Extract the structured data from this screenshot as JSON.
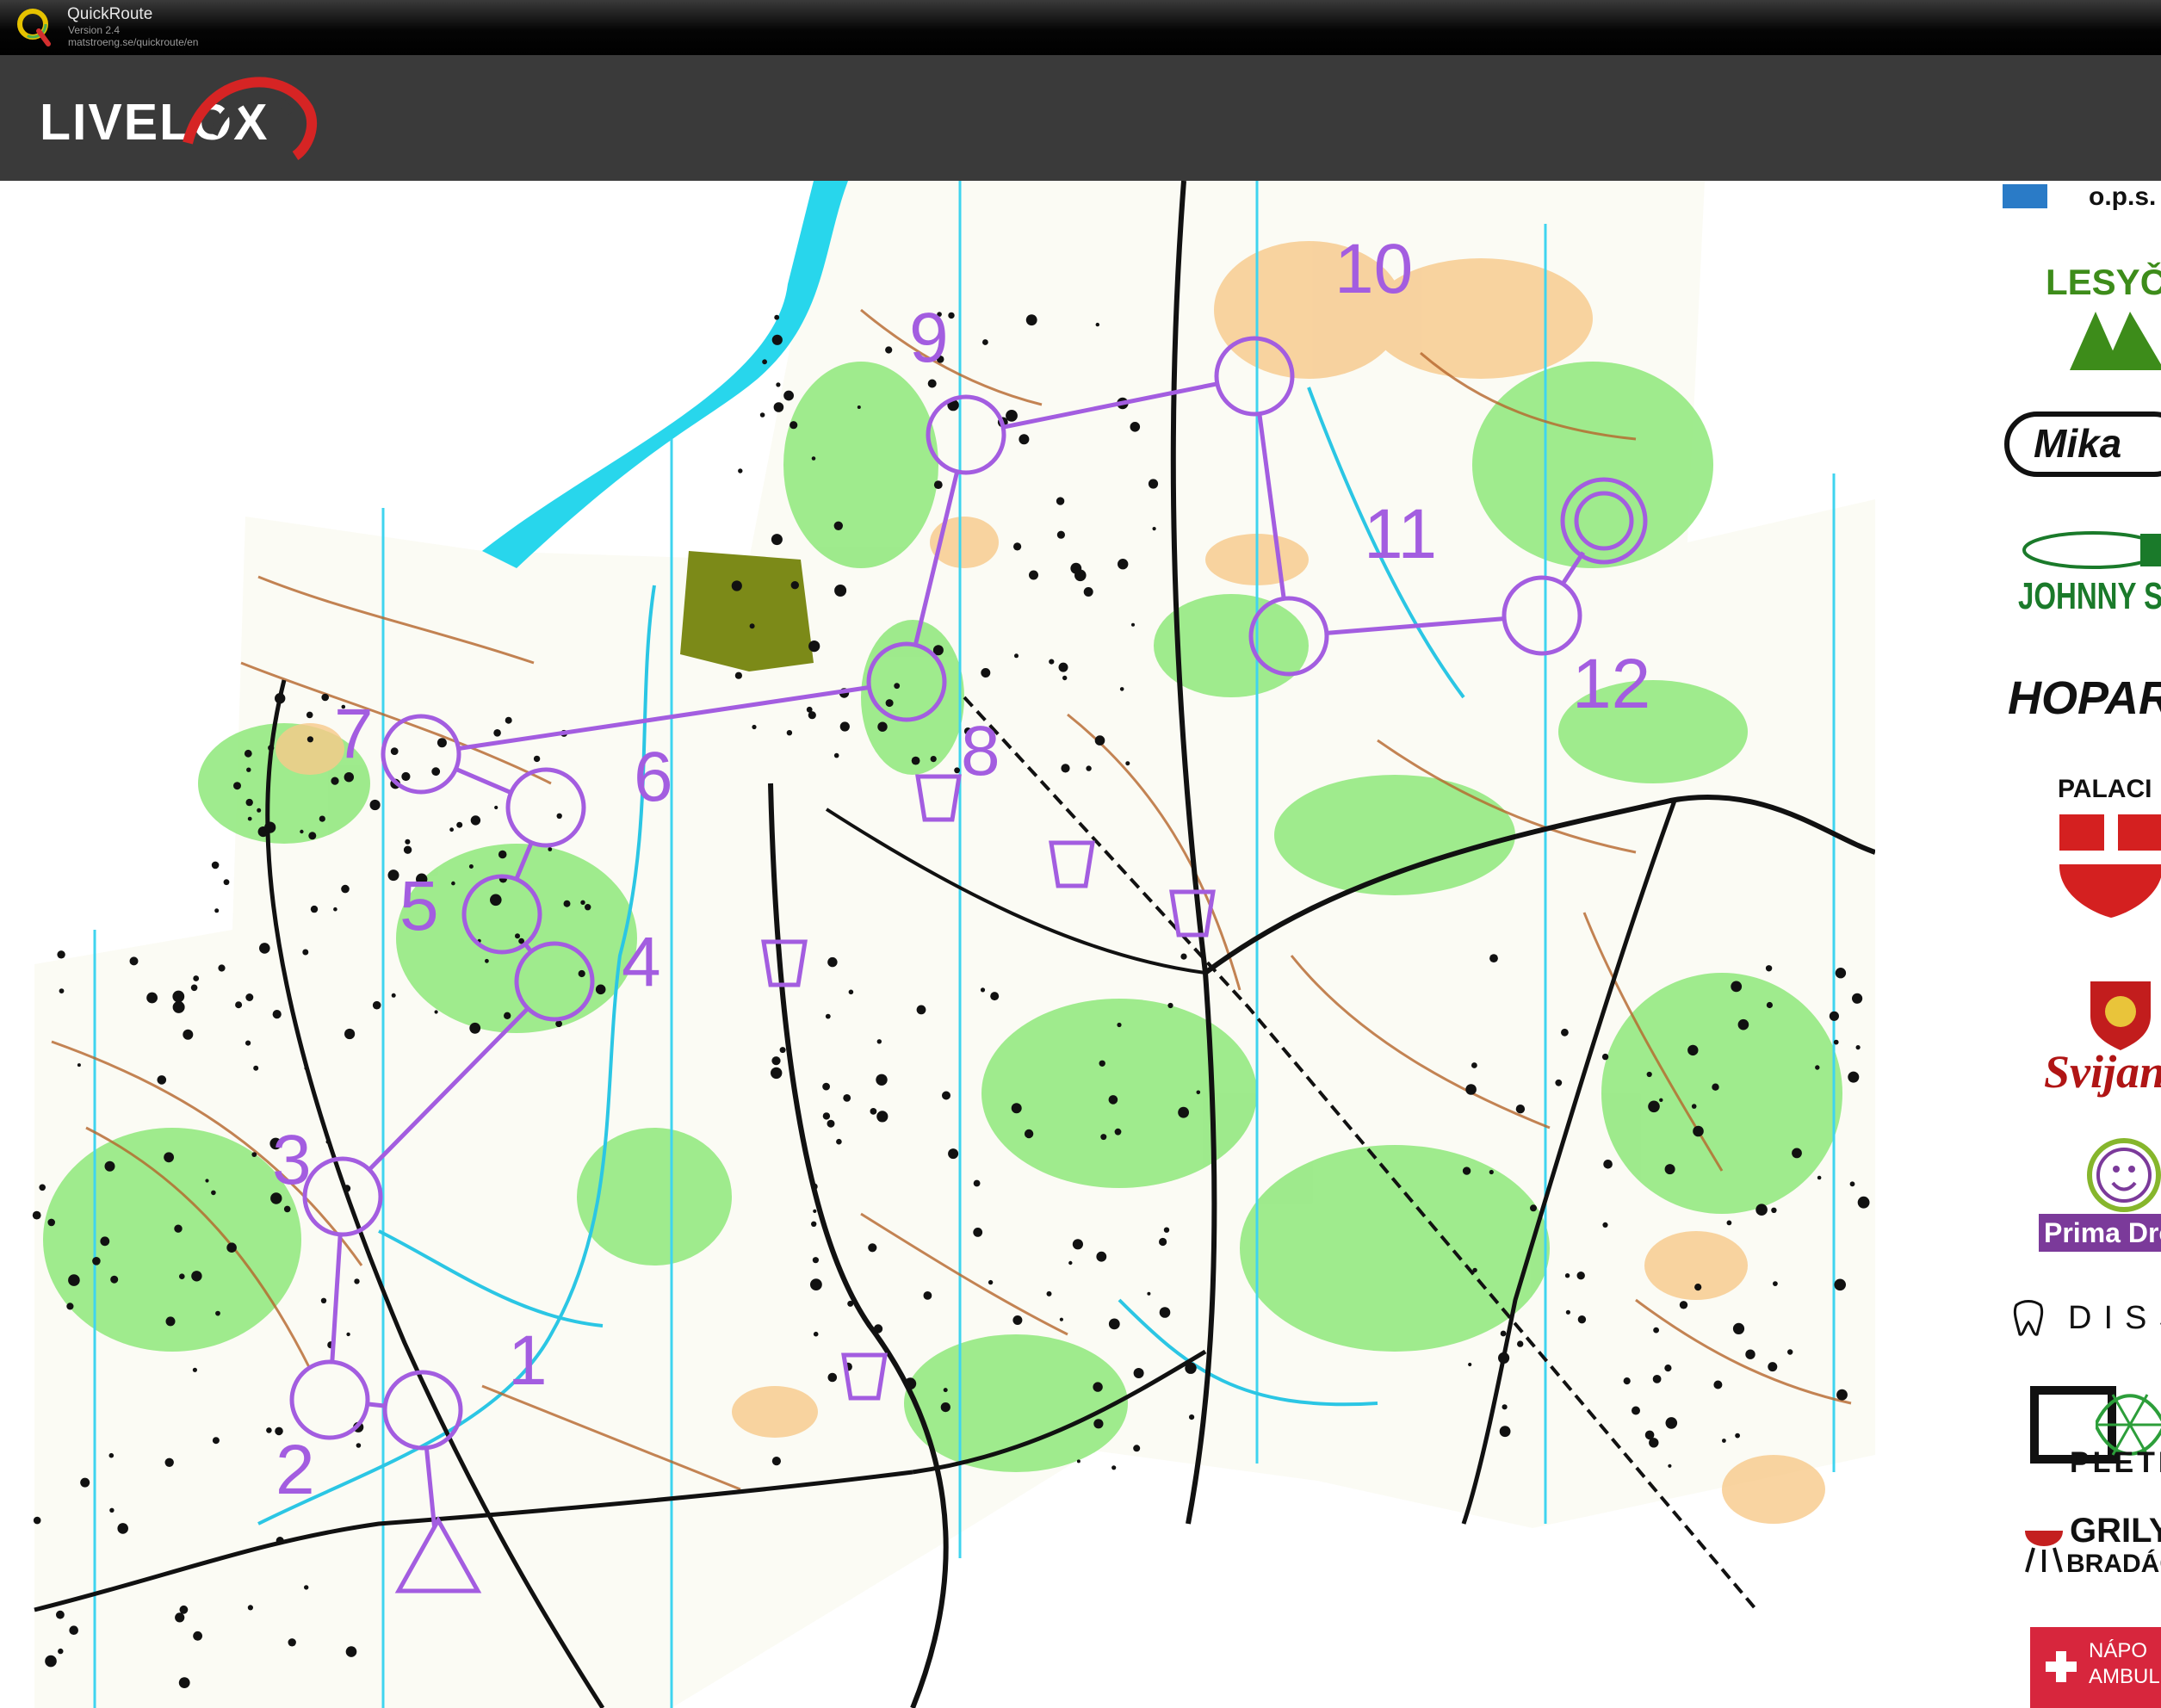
{
  "window": {
    "app_name": "QuickRoute",
    "version": "Version 2.4",
    "url": "matstroeng.se/quickroute/en"
  },
  "header": {
    "brand": "LIVELOX"
  },
  "map": {
    "start_icon": "start-triangle",
    "finish_icon": "finish-double-circle",
    "course_color": "#a35de0",
    "control_labels": [
      "1",
      "2",
      "3",
      "4",
      "5",
      "6",
      "7",
      "8",
      "9",
      "10",
      "11",
      "12"
    ]
  },
  "sponsors": [
    {
      "name": "o.p.s."
    },
    {
      "name": "LESYČ"
    },
    {
      "name": "Mika"
    },
    {
      "name": "JOHNNY SE"
    },
    {
      "name": "HOPAR"
    },
    {
      "name": "PALACI"
    },
    {
      "name": "Svijan"
    },
    {
      "name": "Prima Drog"
    },
    {
      "name": "DISS"
    },
    {
      "name": "PLETIL"
    },
    {
      "name": "GRILY",
      "sub": "BRADÁČ"
    },
    {
      "name": "NÁPO",
      "sub": "AMBUL"
    }
  ]
}
